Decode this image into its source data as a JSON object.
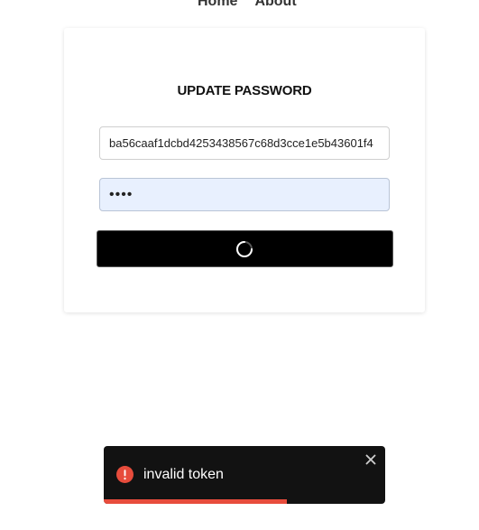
{
  "nav": {
    "items": [
      {
        "label": "Home"
      },
      {
        "label": "About"
      }
    ]
  },
  "form": {
    "title": "UPDATE PASSWORD",
    "token_value": "ba56caaf1dcbd4253438567c68d3cce1e5b43601f4",
    "password_value": "••••",
    "submit_state": "loading"
  },
  "toast": {
    "type": "error",
    "message": "invalid token",
    "progress": 0.65,
    "accent_color": "#e74c3c"
  },
  "icons": {
    "toast_icon": "error-circle-icon",
    "close_icon": "close-icon",
    "spinner": "loading-spinner-icon"
  }
}
